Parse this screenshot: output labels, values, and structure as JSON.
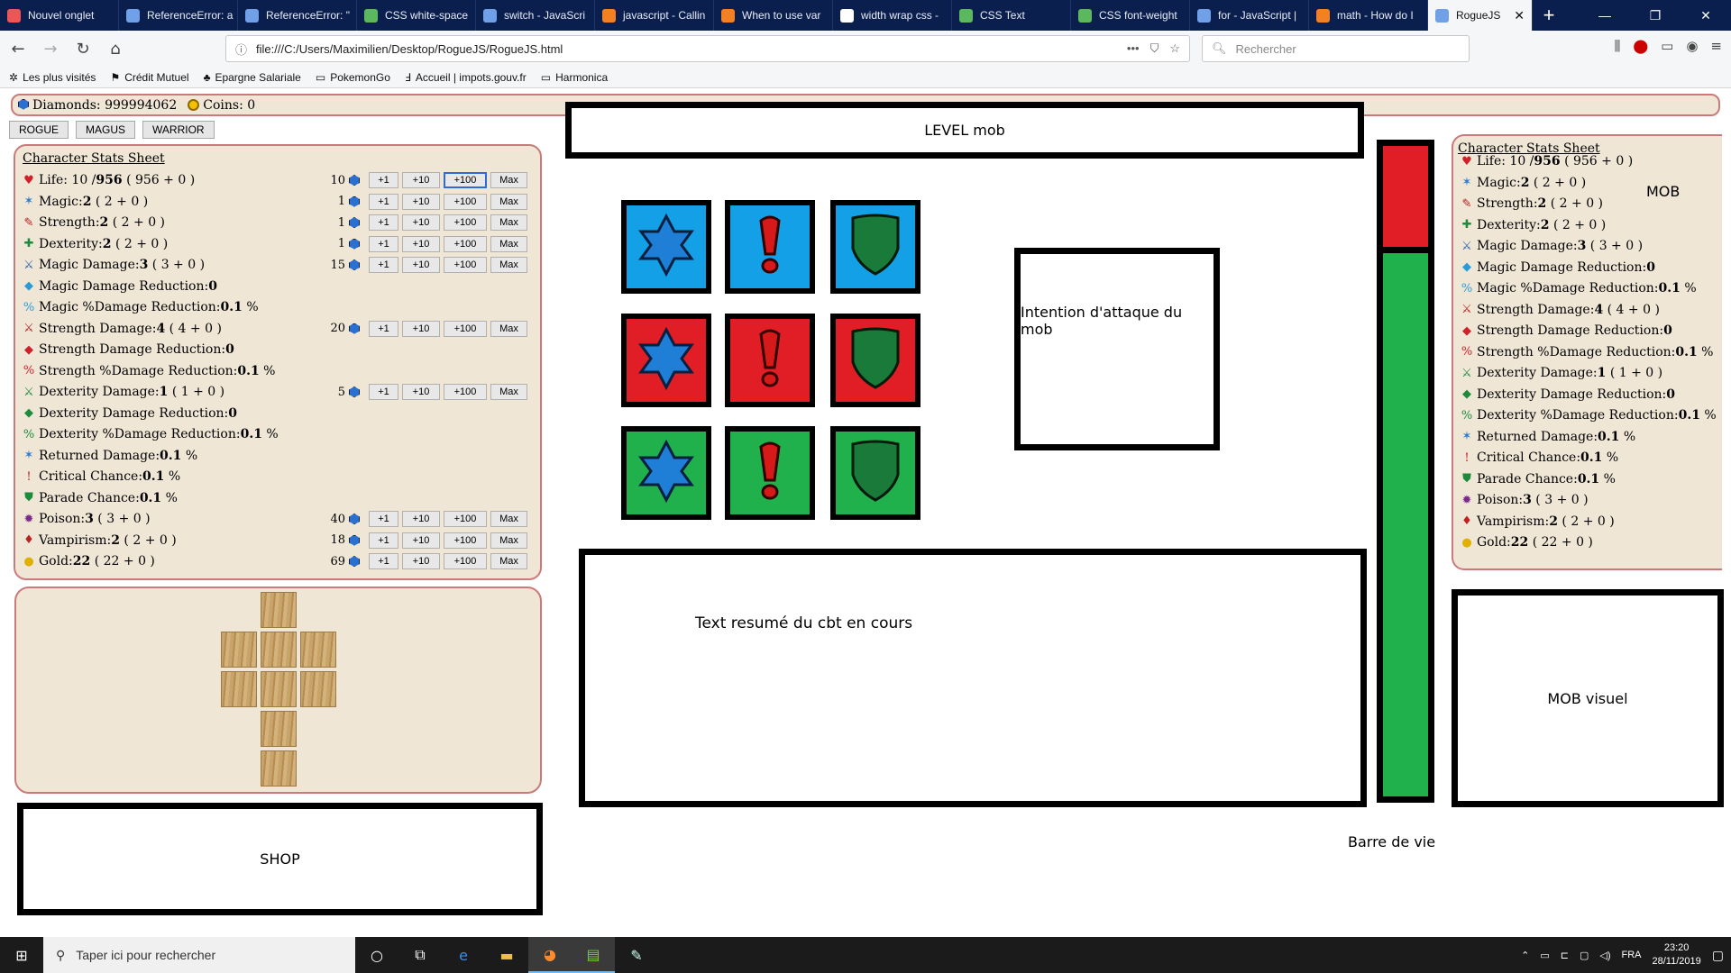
{
  "browser": {
    "tabs": [
      {
        "label": "Nouvel onglet",
        "color": "#e55"
      },
      {
        "label": "ReferenceError: a",
        "color": "#6fa0e8"
      },
      {
        "label": "ReferenceError: \"",
        "color": "#6fa0e8"
      },
      {
        "label": "CSS white-space",
        "color": "#5cb85c"
      },
      {
        "label": "switch - JavaScri",
        "color": "#6fa0e8"
      },
      {
        "label": "javascript - Callin",
        "color": "#f48024"
      },
      {
        "label": "When to use var",
        "color": "#f48024"
      },
      {
        "label": "width wrap css -",
        "color": "#ffffff"
      },
      {
        "label": "CSS Text",
        "color": "#5cb85c"
      },
      {
        "label": "CSS font-weight",
        "color": "#5cb85c"
      },
      {
        "label": "for - JavaScript |",
        "color": "#6fa0e8"
      },
      {
        "label": "math - How do I",
        "color": "#f48024"
      }
    ],
    "active_tab": "RogueJS",
    "url": "file:///C:/Users/Maximilien/Desktop/RogueJS/RogueJS.html",
    "search_placeholder": "Rechercher",
    "bookmarks": [
      "Les plus visités",
      "Crédit Mutuel",
      "Epargne Salariale",
      "PokemonGo",
      "Accueil | impots.gouv.fr",
      "Harmonica"
    ]
  },
  "currency": {
    "diamonds_label": "Diamonds: 999994062",
    "coins_label": "Coins: 0"
  },
  "class_tabs": [
    "ROGUE",
    "MAGUS",
    "WARRIOR"
  ],
  "player_sheet": {
    "title": "Character Stats Sheet",
    "stats": [
      {
        "icon": "heart-icon",
        "glyph": "♥",
        "color": "#d0202a",
        "label": "Life: 10 / ",
        "bold": "956",
        "rest": " ( 956 + 0 )",
        "cost": "10",
        "btns": true,
        "sel": true
      },
      {
        "icon": "star-icon",
        "glyph": "✶",
        "color": "#2a7bd1",
        "label": "Magic: ",
        "bold": "2",
        "rest": " ( 2 + 0 )",
        "cost": "1",
        "btns": true
      },
      {
        "icon": "strength-icon",
        "glyph": "✎",
        "color": "#c02020",
        "label": "Strength: ",
        "bold": "2",
        "rest": " ( 2 + 0 )",
        "cost": "1",
        "btns": true
      },
      {
        "icon": "dexterity-icon",
        "glyph": "✚",
        "color": "#1e8a3c",
        "label": "Dexterity: ",
        "bold": "2",
        "rest": " ( 2 + 0 )",
        "cost": "1",
        "btns": true
      },
      {
        "icon": "sword-icon",
        "glyph": "⚔",
        "color": "#2a5fb0",
        "label": "Magic Damage: ",
        "bold": "3",
        "rest": " ( 3 + 0 )",
        "cost": "15",
        "btns": true
      },
      {
        "icon": "diamond-icon",
        "glyph": "◆",
        "color": "#2a9bd8",
        "label": "Magic Damage Reduction: ",
        "bold": "0",
        "rest": "",
        "btns": false
      },
      {
        "icon": "percent-icon",
        "glyph": "%",
        "color": "#2a9bd8",
        "label": "Magic %Damage Reduction: ",
        "bold": "0.1",
        "rest": " %",
        "btns": false
      },
      {
        "icon": "sword-icon",
        "glyph": "⚔",
        "color": "#b02020",
        "label": "Strength Damage: ",
        "bold": "4",
        "rest": " ( 4 + 0 )",
        "cost": "20",
        "btns": true
      },
      {
        "icon": "diamond-icon",
        "glyph": "◆",
        "color": "#d0202a",
        "label": "Strength Damage Reduction: ",
        "bold": "0",
        "rest": "",
        "btns": false
      },
      {
        "icon": "percent-icon",
        "glyph": "%",
        "color": "#d0202a",
        "label": "Strength %Damage Reduction: ",
        "bold": "0.1",
        "rest": " %",
        "btns": false
      },
      {
        "icon": "sword-icon",
        "glyph": "⚔",
        "color": "#1e8a3c",
        "label": "Dexterity Damage: ",
        "bold": "1",
        "rest": " ( 1 + 0 )",
        "cost": "5",
        "btns": true
      },
      {
        "icon": "diamond-icon",
        "glyph": "◆",
        "color": "#1e8a3c",
        "label": "Dexterity Damage Reduction: ",
        "bold": "0",
        "rest": "",
        "btns": false
      },
      {
        "icon": "percent-icon",
        "glyph": "%",
        "color": "#1e8a3c",
        "label": "Dexterity %Damage Reduction: ",
        "bold": "0.1",
        "rest": " %",
        "btns": false
      },
      {
        "icon": "star-icon",
        "glyph": "✶",
        "color": "#2a7bd1",
        "label": "Returned Damage: ",
        "bold": "0.1",
        "rest": " %",
        "btns": false
      },
      {
        "icon": "exclamation-icon",
        "glyph": "!",
        "color": "#c02020",
        "label": "Critical Chance: ",
        "bold": "0.1",
        "rest": " %",
        "btns": false
      },
      {
        "icon": "shield-icon",
        "glyph": "⛊",
        "color": "#1e8a3c",
        "label": "Parade Chance: ",
        "bold": "0.1",
        "rest": " %",
        "btns": false
      },
      {
        "icon": "poison-icon",
        "glyph": "✹",
        "color": "#7a2a8a",
        "label": "Poison: ",
        "bold": "3",
        "rest": " ( 3 + 0 )",
        "cost": "40",
        "btns": true
      },
      {
        "icon": "blood-icon",
        "glyph": "♦",
        "color": "#c02020",
        "label": "Vampirism: ",
        "bold": "2",
        "rest": " ( 2 + 0 )",
        "cost": "18",
        "btns": true
      },
      {
        "icon": "coin-icon",
        "glyph": "●",
        "color": "#e0b000",
        "label": "Gold: ",
        "bold": "22",
        "rest": " ( 22 + 0 )",
        "cost": "69",
        "btns": true
      }
    ],
    "buttons": [
      "+1",
      "+10",
      "+100",
      "Max"
    ]
  },
  "mob_sheet": {
    "title": "Character Stats Sheet",
    "mob_label": "MOB",
    "stats": [
      {
        "icon": "heart-icon",
        "glyph": "♥",
        "color": "#d0202a",
        "label": "Life: 10 / ",
        "bold": "956",
        "rest": " ( 956 + 0 )"
      },
      {
        "icon": "star-icon",
        "glyph": "✶",
        "color": "#2a7bd1",
        "label": "Magic: ",
        "bold": "2",
        "rest": " ( 2 + 0 )"
      },
      {
        "icon": "strength-icon",
        "glyph": "✎",
        "color": "#c02020",
        "label": "Strength: ",
        "bold": "2",
        "rest": " ( 2 + 0 )"
      },
      {
        "icon": "dexterity-icon",
        "glyph": "✚",
        "color": "#1e8a3c",
        "label": "Dexterity: ",
        "bold": "2",
        "rest": " ( 2 + 0 )"
      },
      {
        "icon": "sword-icon",
        "glyph": "⚔",
        "color": "#2a5fb0",
        "label": "Magic Damage: ",
        "bold": "3",
        "rest": " ( 3 + 0 )"
      },
      {
        "icon": "diamond-icon",
        "glyph": "◆",
        "color": "#2a9bd8",
        "label": "Magic Damage Reduction: ",
        "bold": "0",
        "rest": ""
      },
      {
        "icon": "percent-icon",
        "glyph": "%",
        "color": "#2a9bd8",
        "label": "Magic %Damage Reduction: ",
        "bold": "0.1",
        "rest": " %"
      },
      {
        "icon": "sword-icon",
        "glyph": "⚔",
        "color": "#b02020",
        "label": "Strength Damage: ",
        "bold": "4",
        "rest": " ( 4 + 0 )"
      },
      {
        "icon": "diamond-icon",
        "glyph": "◆",
        "color": "#d0202a",
        "label": "Strength Damage Reduction: ",
        "bold": "0",
        "rest": ""
      },
      {
        "icon": "percent-icon",
        "glyph": "%",
        "color": "#d0202a",
        "label": "Strength %Damage Reduction: ",
        "bold": "0.1",
        "rest": " %"
      },
      {
        "icon": "sword-icon",
        "glyph": "⚔",
        "color": "#1e8a3c",
        "label": "Dexterity Damage: ",
        "bold": "1",
        "rest": " ( 1 + 0 )"
      },
      {
        "icon": "diamond-icon",
        "glyph": "◆",
        "color": "#1e8a3c",
        "label": "Dexterity Damage Reduction: ",
        "bold": "0",
        "rest": ""
      },
      {
        "icon": "percent-icon",
        "glyph": "%",
        "color": "#1e8a3c",
        "label": "Dexterity %Damage Reduction: ",
        "bold": "0.1",
        "rest": " %"
      },
      {
        "icon": "star-icon",
        "glyph": "✶",
        "color": "#2a7bd1",
        "label": "Returned Damage: ",
        "bold": "0.1",
        "rest": " %"
      },
      {
        "icon": "exclamation-icon",
        "glyph": "!",
        "color": "#c02020",
        "label": "Critical Chance: ",
        "bold": "0.1",
        "rest": " %"
      },
      {
        "icon": "shield-icon",
        "glyph": "⛊",
        "color": "#1e8a3c",
        "label": "Parade Chance: ",
        "bold": "0.1",
        "rest": " %"
      },
      {
        "icon": "poison-icon",
        "glyph": "✹",
        "color": "#7a2a8a",
        "label": "Poison: ",
        "bold": "3",
        "rest": " ( 3 + 0 )"
      },
      {
        "icon": "blood-icon",
        "glyph": "♦",
        "color": "#c02020",
        "label": "Vampirism: ",
        "bold": "2",
        "rest": " ( 2 + 0 )"
      },
      {
        "icon": "coin-icon",
        "glyph": "●",
        "color": "#e0b000",
        "label": "Gold: ",
        "bold": "22",
        "rest": " ( 22 + 0 )"
      }
    ]
  },
  "game": {
    "level_label": "LEVEL mob",
    "intention_label": "Intention d'attaque du mob",
    "summary_label": "Text resumé du cbt en cours",
    "mob_visual_label": "MOB visuel",
    "shop_label": "SHOP",
    "lifebar_label": "Barre de vie",
    "life_fraction": 0.155,
    "tile_rows": [
      "blue",
      "red",
      "green"
    ],
    "tile_icons": [
      "star-icon",
      "exclamation-icon",
      "shield-icon"
    ],
    "colors": {
      "blue": "#14a0e6",
      "red": "#e11d25",
      "green": "#21b14c"
    }
  },
  "taskbar": {
    "search_placeholder": "Taper ici pour rechercher",
    "lang": "FRA",
    "time": "23:20",
    "date": "28/11/2019"
  }
}
